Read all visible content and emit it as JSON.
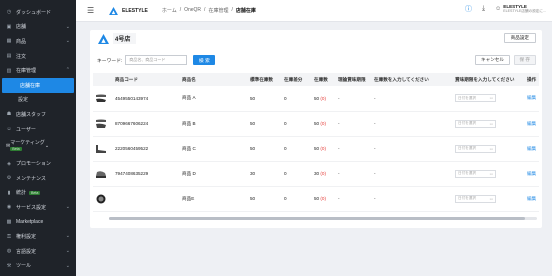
{
  "sidebar": {
    "items": [
      {
        "label": "ダッシュボード",
        "icon": "dashboard-icon",
        "chevron": false
      },
      {
        "label": "店舗",
        "icon": "store-icon",
        "chevron": true
      },
      {
        "label": "商品",
        "icon": "product-icon",
        "chevron": true
      },
      {
        "label": "注文",
        "icon": "order-icon",
        "chevron": false
      },
      {
        "label": "在庫管理",
        "icon": "inventory-icon",
        "chevron": true,
        "expanded": true
      }
    ],
    "sub_items": [
      {
        "label": "店舗在庫",
        "active": true
      },
      {
        "label": "設定",
        "active": false
      }
    ],
    "items2": [
      {
        "label": "店舗スタッフ",
        "icon": "staff-icon",
        "chevron": false
      },
      {
        "label": "ユーザー",
        "icon": "user-icon",
        "chevron": false
      }
    ],
    "marketing": {
      "label": "マーケティング",
      "badge": "Beta"
    },
    "items3": [
      {
        "label": "プロモーション",
        "icon": "promotion-icon",
        "chevron": false
      },
      {
        "label": "メンテナンス",
        "icon": "maintenance-icon",
        "chevron": false
      }
    ],
    "stats": {
      "label": "統計",
      "badge": "Beta"
    },
    "items4": [
      {
        "label": "サービス設定",
        "icon": "service-icon",
        "chevron": true
      },
      {
        "label": "Marketplace",
        "icon": "marketplace-icon",
        "chevron": false
      },
      {
        "label": "権利設定",
        "icon": "rights-icon",
        "chevron": true
      },
      {
        "label": "言語設定",
        "icon": "language-icon",
        "chevron": true
      },
      {
        "label": "ツール",
        "icon": "tool-icon",
        "chevron": true
      }
    ]
  },
  "header": {
    "brand": "ELESTYLE",
    "breadcrumb": [
      "ホーム",
      "OneQR",
      "在庫管理",
      "店舗在庫"
    ],
    "user_name": "ELESTYLE",
    "user_sub": "ELESTYLE店舗の設定に..."
  },
  "main": {
    "store_name": "4号店",
    "settings_button": "商品設定",
    "keyword_label": "キーワード:",
    "keyword_placeholder": "商品名、商品コード",
    "search_button": "検 索",
    "cancel_button": "キャンセル",
    "save_button": "保 存",
    "columns": [
      "商品コード",
      "商品名",
      "標準在庫数",
      "在庫差分",
      "在庫数",
      "理論賞味期限",
      "在庫数を入力してください",
      "賞味期限を入力してください",
      "操作"
    ],
    "rows": [
      {
        "code": "4549550143974",
        "name": "商品 A",
        "standard": "50",
        "diff": "0",
        "stock": "50",
        "stock_delta": "(0)",
        "theory": "-",
        "input_stock": "-",
        "date_placeholder": "日付を選択",
        "action": "編集"
      },
      {
        "code": "8709667606224",
        "name": "商品 B",
        "standard": "50",
        "diff": "0",
        "stock": "50",
        "stock_delta": "(0)",
        "theory": "-",
        "input_stock": "-",
        "date_placeholder": "日付を選択",
        "action": "編集"
      },
      {
        "code": "2220560459522",
        "name": "商品 C",
        "standard": "50",
        "diff": "0",
        "stock": "50",
        "stock_delta": "(0)",
        "theory": "-",
        "input_stock": "-",
        "date_placeholder": "日付を選択",
        "action": "編集"
      },
      {
        "code": "7947408635229",
        "name": "商品 D",
        "standard": "30",
        "diff": "0",
        "stock": "30",
        "stock_delta": "(0)",
        "theory": "-",
        "input_stock": "-",
        "date_placeholder": "日付を選択",
        "action": "編集"
      },
      {
        "code": "",
        "name": "商品E",
        "standard": "50",
        "diff": "0",
        "stock": "50",
        "stock_delta": "(0)",
        "theory": "-",
        "input_stock": "-",
        "date_placeholder": "日付を選択",
        "action": "編集"
      }
    ]
  },
  "colors": {
    "accent": "#1e88e5",
    "sidebar_bg": "#1f2329",
    "delta_red": "#e53935"
  }
}
